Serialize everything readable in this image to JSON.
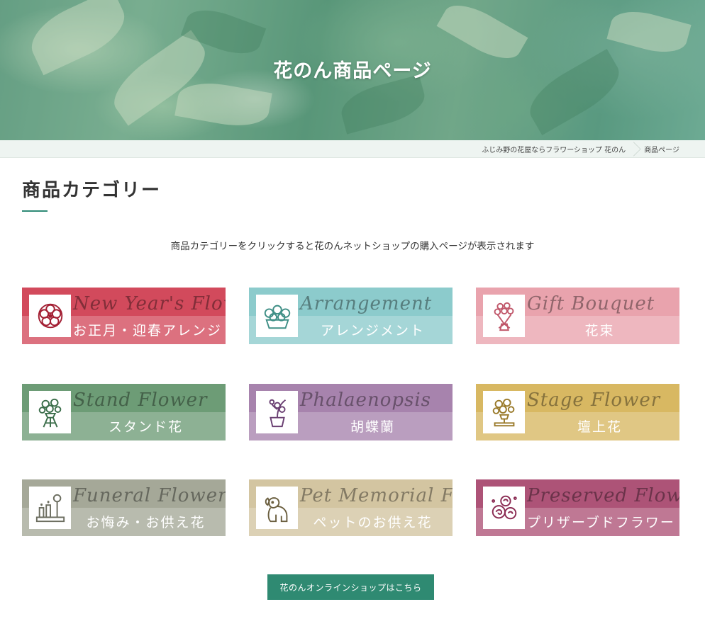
{
  "hero": {
    "title": "花のん商品ページ"
  },
  "breadcrumb": {
    "home": "ふじみ野の花屋ならフラワーショップ 花のん",
    "current": "商品ページ"
  },
  "section": {
    "title": "商品カテゴリー",
    "intro": "商品カテゴリーをクリックすると花のんネットショップの購入ページが表示されます"
  },
  "categories": [
    {
      "script": "New Year's Flower",
      "label": "お正月・迎春アレンジ",
      "color": "#d24a5c",
      "icon": "plum-blossom-icon"
    },
    {
      "script": "Arrangement",
      "label": "アレンジメント",
      "color": "#8ccbcc",
      "icon": "flower-arrangement-icon"
    },
    {
      "script": "Gift Bouquet",
      "label": "花束",
      "color": "#e9a3ad",
      "icon": "bouquet-icon"
    },
    {
      "script": "Stand Flower",
      "label": "スタンド花",
      "color": "#6d9c76",
      "icon": "stand-flower-icon"
    },
    {
      "script": "Phalaenopsis",
      "label": "胡蝶蘭",
      "color": "#a783ad",
      "icon": "orchid-icon"
    },
    {
      "script": "Stage Flower",
      "label": "壇上花",
      "color": "#d8b862",
      "icon": "stage-flower-icon"
    },
    {
      "script": "Funeral Flower",
      "label": "お悔み・お供え花",
      "color": "#a5a898",
      "icon": "candles-icon"
    },
    {
      "script": "Pet Memorial Flowers",
      "label": "ペットのお供え花",
      "color": "#d3c5a1",
      "icon": "pet-icon"
    },
    {
      "script": "Preserved Flower",
      "label": "プリザーブドフラワー",
      "color": "#ad5377",
      "icon": "roses-icon"
    }
  ],
  "shop_button": {
    "label": "花のんオンラインショップはこちら"
  }
}
